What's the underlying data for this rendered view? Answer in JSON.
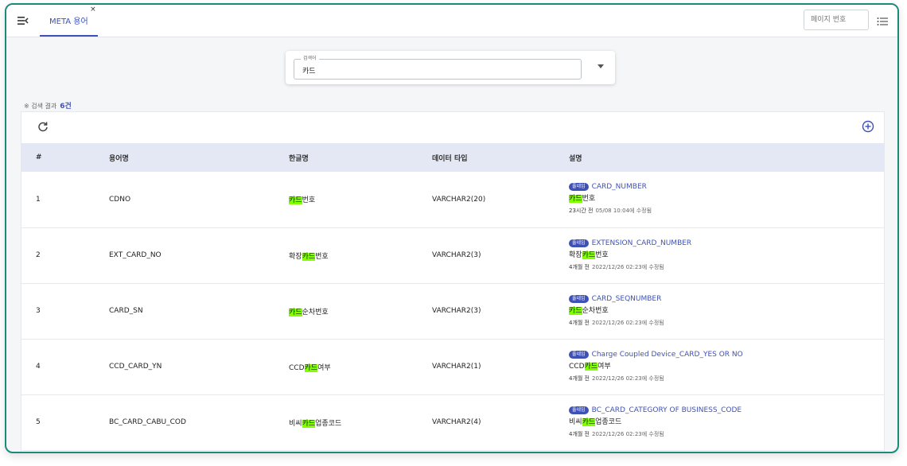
{
  "tab": {
    "label": "META 용어",
    "close": "×"
  },
  "page_input": {
    "placeholder": "페이지 번호"
  },
  "search": {
    "label": "검색어",
    "value": "카드"
  },
  "result": {
    "prefix": "※ 검색 결과",
    "count": "6건"
  },
  "table": {
    "headers": [
      "#",
      "용어명",
      "한글명",
      "데이터 타입",
      "설명"
    ],
    "rows": [
      {
        "num": "1",
        "term": "CDNO",
        "kor_pre": "",
        "kor_hl": "카드",
        "kor_post": "번호",
        "type": "VARCHAR2(20)",
        "badge": "풀네임",
        "eng": "CARD_NUMBER",
        "desc_pre": "",
        "desc_hl": "카드",
        "desc_post": "번호",
        "ago": "23시간 전",
        "modified": "05/08 10:04에 수정됨"
      },
      {
        "num": "2",
        "term": "EXT_CARD_NO",
        "kor_pre": "확장",
        "kor_hl": "카드",
        "kor_post": "번호",
        "type": "VARCHAR2(3)",
        "badge": "풀네임",
        "eng": "EXTENSION_CARD_NUMBER",
        "desc_pre": "확장",
        "desc_hl": "카드",
        "desc_post": "번호",
        "ago": "4개월 전",
        "modified": "2022/12/26 02:23에 수정됨"
      },
      {
        "num": "3",
        "term": "CARD_SN",
        "kor_pre": "",
        "kor_hl": "카드",
        "kor_post": "순차번호",
        "type": "VARCHAR2(3)",
        "badge": "풀네임",
        "eng": "CARD_SEQNUMBER",
        "desc_pre": "",
        "desc_hl": "카드",
        "desc_post": "순차번호",
        "ago": "4개월 전",
        "modified": "2022/12/26 02:23에 수정됨"
      },
      {
        "num": "4",
        "term": "CCD_CARD_YN",
        "kor_pre": "CCD",
        "kor_hl": "카드",
        "kor_post": "여부",
        "type": "VARCHAR2(1)",
        "badge": "풀네임",
        "eng": "Charge Coupled Device_CARD_YES OR NO",
        "desc_pre": "CCD",
        "desc_hl": "카드",
        "desc_post": "여부",
        "ago": "4개월 전",
        "modified": "2022/12/26 02:23에 수정됨"
      },
      {
        "num": "5",
        "term": "BC_CARD_CABU_COD",
        "kor_pre": "비씨",
        "kor_hl": "카드",
        "kor_post": "업종코드",
        "type": "VARCHAR2(4)",
        "badge": "풀네임",
        "eng": "BC_CARD_CATEGORY OF BUSINESS_CODE",
        "desc_pre": "비씨",
        "desc_hl": "카드",
        "desc_post": "업종코드",
        "ago": "4개월 전",
        "modified": "2022/12/26 02:23에 수정됨"
      }
    ]
  },
  "icons": {
    "menu": "menu-collapse-icon",
    "list": "list-icon",
    "refresh": "refresh-icon",
    "add": "add-circle-icon",
    "dropdown": "chevron-down-icon"
  },
  "colors": {
    "accent": "#3f51b5",
    "highlight": "#7fff00",
    "frame": "#1c8a78",
    "header_bg": "#e3e8f4"
  }
}
